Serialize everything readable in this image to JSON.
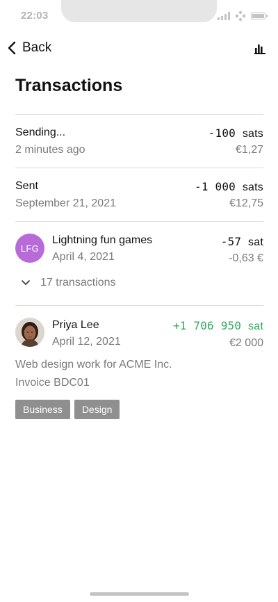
{
  "status_bar": {
    "time": "22:03"
  },
  "nav": {
    "back_label": "Back"
  },
  "page": {
    "title": "Transactions"
  },
  "transactions": [
    {
      "title": "Sending...",
      "subtitle": "2 minutes ago",
      "amount": "-100",
      "unit": "sats",
      "fiat": "€1,27"
    },
    {
      "title": "Sent",
      "subtitle": "September 21, 2021",
      "amount": "-1 000",
      "unit": "sats",
      "fiat": "€12,75"
    },
    {
      "title": "Lightning fun games",
      "subtitle": "April 4, 2021",
      "amount": "-57",
      "unit": "sat",
      "fiat": "-0,63 €",
      "avatar_initials": "LFG",
      "avatar_color": "#b96ad9",
      "expand_label": "17 transactions"
    },
    {
      "title": "Priya Lee",
      "subtitle": "April 12, 2021",
      "amount": "+1 706 950",
      "unit": "sat",
      "fiat": "€2 000",
      "amount_color": "#2eaa5c",
      "description": "Web design work for ACME Inc.",
      "invoice": "Invoice BDC01",
      "tags": [
        "Business",
        "Design"
      ]
    }
  ],
  "icons": {
    "back": "chevron-left-icon",
    "chart": "bar-chart-icon",
    "expand": "chevron-down-icon"
  }
}
